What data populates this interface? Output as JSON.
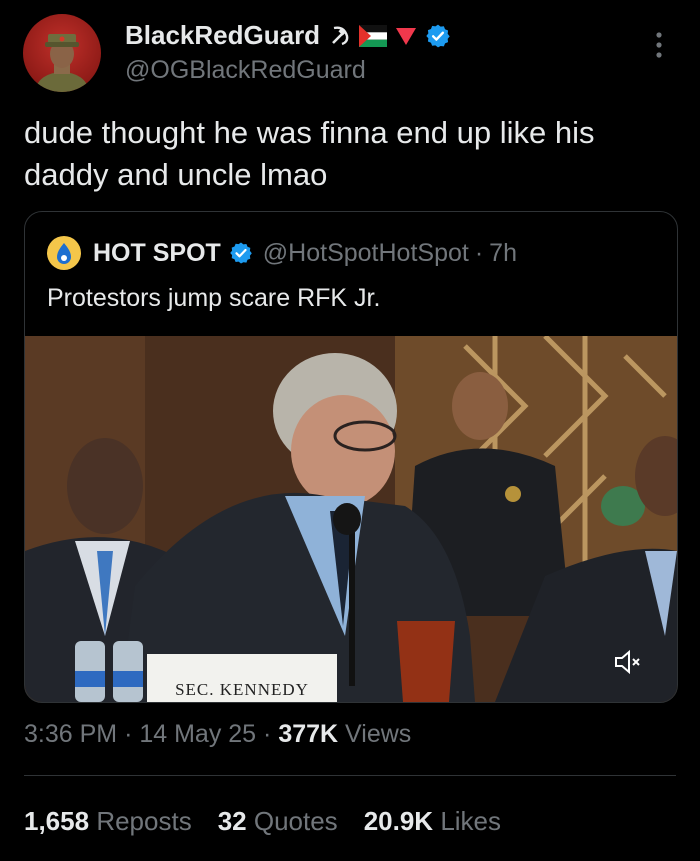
{
  "author": {
    "name": "BlackRedGuard",
    "handle": "@OGBlackRedGuard",
    "name_emojis": [
      "hammer-and-sickle",
      "palestine-flag",
      "red-triangle"
    ]
  },
  "tweet": {
    "text": "dude thought he was finna end up like his daddy and uncle lmao"
  },
  "quoted": {
    "name": "HOT SPOT",
    "handle": "@HotSpotHotSpot",
    "separator": "·",
    "time": "7h",
    "text": "Protestors jump scare RFK Jr.",
    "media": {
      "nameplate": "SEC. KENNEDY",
      "mute_icon": "speaker-muted-icon"
    }
  },
  "meta": {
    "time": "3:36 PM",
    "dot1": "·",
    "date": "14 May 25",
    "dot2": "·",
    "views_count": "377K",
    "views_label": "Views"
  },
  "stats": {
    "reposts_count": "1,658",
    "reposts_label": "Reposts",
    "quotes_count": "32",
    "quotes_label": "Quotes",
    "likes_count": "20.9K",
    "likes_label": "Likes"
  },
  "colors": {
    "background": "#000000",
    "text": "#e7e9ea",
    "muted": "#71767b",
    "verified": "#1d9bf0",
    "border": "#2f3336"
  }
}
